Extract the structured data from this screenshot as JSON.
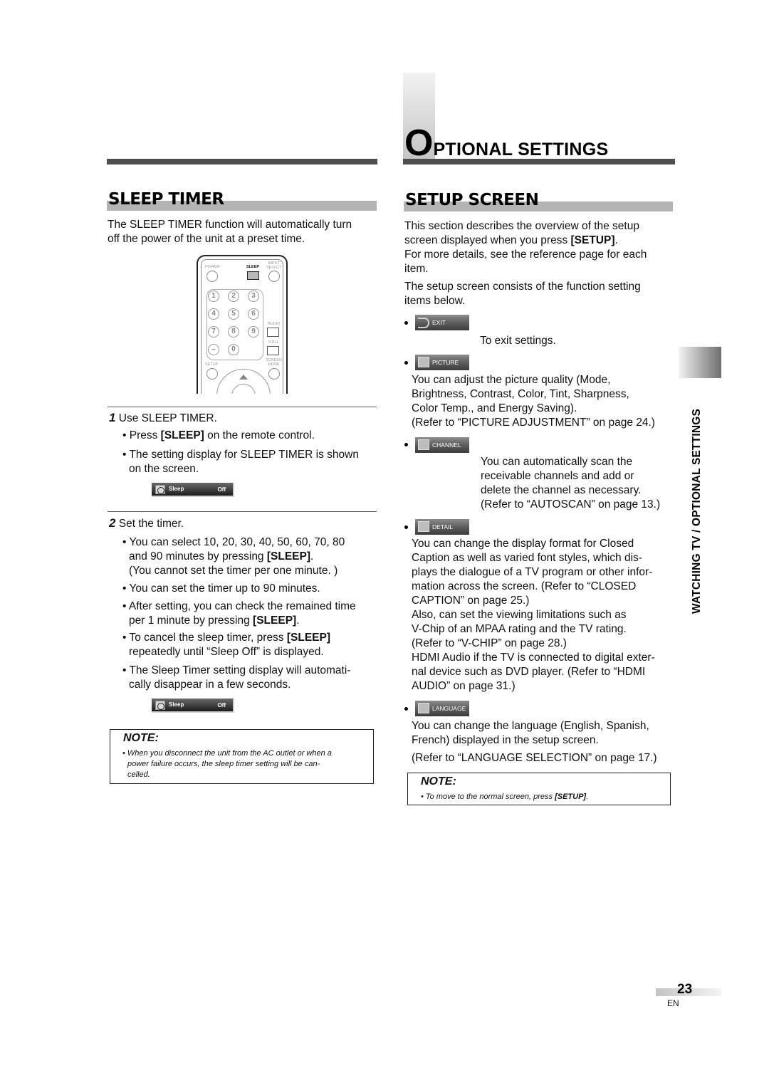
{
  "header": {
    "title_initial": "O",
    "title_rest": "PTIONAL SETTINGS"
  },
  "side_tab": {
    "label": "WATCHING TV / OPTIONAL SETTINGS"
  },
  "sleep_timer": {
    "heading": "SLEEP TIMER",
    "intro_line1": "The SLEEP TIMER function will automatically turn",
    "intro_line2": "off the power of the unit at a preset time.",
    "remote": {
      "labels": {
        "power": "POWER",
        "sleep": "SLEEP",
        "input_select_1": "INPUT",
        "input_select_2": "SELECT",
        "audio": "AUDIO",
        "still": "STILL",
        "setup": "SETUP",
        "screen_mode_1": "SCREEN",
        "screen_mode_2": "MODE"
      },
      "keys": [
        "1",
        "2",
        "3",
        "4",
        "5",
        "6",
        "7",
        "8",
        "9",
        "–",
        "0"
      ]
    },
    "step1": {
      "number": "1",
      "title": "Use SLEEP TIMER.",
      "bullet1_pre": "Press ",
      "bullet1_bold": "[SLEEP]",
      "bullet1_post": " on the remote control.",
      "bullet2_line1": "The setting display for SLEEP TIMER is shown",
      "bullet2_line2": "on the screen."
    },
    "osd": {
      "label": "Sleep",
      "value": "Off"
    },
    "step2": {
      "number": "2",
      "title": "Set the timer.",
      "b1_line1": "You can select 10, 20, 30, 40, 50, 60, 70, 80",
      "b1_line2_pre": "and 90 minutes by pressing ",
      "b1_line2_bold": "[SLEEP]",
      "b1_line2_post": ".",
      "b1_line3": "(You cannot set the timer per one minute. )",
      "b2": "You can set the timer up to 90 minutes.",
      "b3_line1": "After setting, you can check the remained time",
      "b3_line2_pre": "per 1 minute by pressing ",
      "b3_line2_bold": "[SLEEP]",
      "b3_line2_post": ".",
      "b4_line1_pre": "To cancel the sleep timer, press ",
      "b4_line1_bold": "[SLEEP]",
      "b4_line2": "repeatedly until “Sleep Off” is displayed.",
      "b5_line1": "The Sleep Timer setting display will automati-",
      "b5_line2": "cally disappear in a few seconds."
    },
    "note": {
      "title": "NOTE:",
      "line1": "• When you disconnect the unit from the AC outlet or when a",
      "line2": "power failure occurs, the sleep timer setting will be can-",
      "line3": "celled."
    }
  },
  "setup_screen": {
    "heading": "SETUP SCREEN",
    "intro_line1": "This section describes the overview of the setup",
    "intro_line2_pre": "screen displayed when you press ",
    "intro_line2_bold": "[SETUP]",
    "intro_line2_post": ".",
    "intro_line3": "For more details, see the reference page for each",
    "intro_line4": "item.",
    "intro_line5": "The setup screen consists of the function setting",
    "intro_line6": "items below.",
    "items": [
      {
        "label": "EXIT",
        "icon": "exit-arrow-icon",
        "lines": [
          "To exit settings."
        ]
      },
      {
        "label": "PICTURE",
        "icon": "picture-icon",
        "lines": [
          "You can adjust the picture quality (Mode,",
          "Brightness, Contrast, Color, Tint, Sharpness,",
          "Color Temp., and Energy Saving).",
          "(Refer to “PICTURE ADJUSTMENT” on page 24.)"
        ]
      },
      {
        "label": "CHANNEL",
        "icon": "channel-grid-icon",
        "lines": [
          "You can automatically scan the",
          "receivable channels and add or",
          "delete the channel as necessary.",
          "(Refer to “AUTOSCAN” on page 13.)"
        ]
      },
      {
        "label": "DETAIL",
        "icon": "detail-pages-icon",
        "lines": [
          "You can change the display format for Closed",
          "Caption as well as varied font styles, which dis-",
          "plays the dialogue of a TV program or other infor-",
          "mation across the screen. (Refer to “CLOSED",
          "CAPTION” on page 25.)",
          "Also, can set the viewing limitations such as",
          "V-Chip of an MPAA rating and the TV rating.",
          "(Refer to “V-CHIP” on page 28.)",
          "HDMI Audio if the TV is connected to digital exter-",
          "nal device such as DVD player. (Refer to “HDMI",
          "AUDIO” on page 31.)"
        ]
      },
      {
        "label": "LANGUAGE",
        "icon": "language-icon",
        "lines": [
          "You can change the language (English, Spanish,",
          "French) displayed in the setup screen.",
          "(Refer to “LANGUAGE SELECTION” on page 17.)"
        ]
      }
    ],
    "note": {
      "title": "NOTE:",
      "line_pre": "• To move to the normal screen, press ",
      "line_bold": "[SETUP]",
      "line_post": "."
    }
  },
  "footer": {
    "page_number": "23",
    "language": "EN"
  }
}
